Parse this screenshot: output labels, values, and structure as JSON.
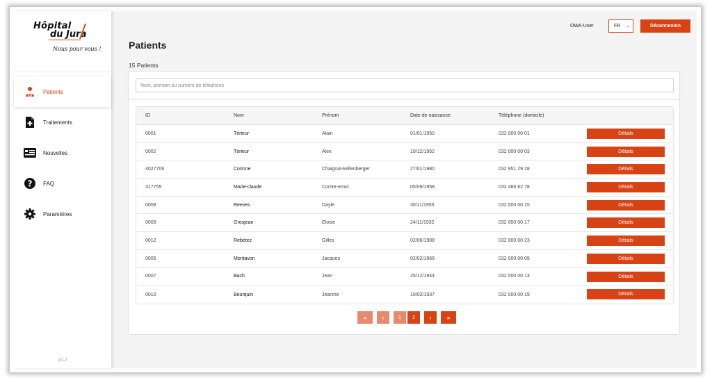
{
  "brand": {
    "name_line1": "Hôpital",
    "name_line2": "du Jura",
    "tagline": "Nous pour vous !",
    "accent_color": "#d84315"
  },
  "sidebar": {
    "items": [
      {
        "label": "Patients",
        "icon": "patient-icon",
        "active": true
      },
      {
        "label": "Traitements",
        "icon": "document-icon",
        "active": false
      },
      {
        "label": "Nouvelles",
        "icon": "news-icon",
        "active": false
      },
      {
        "label": "FAQ",
        "icon": "question-icon",
        "active": false
      },
      {
        "label": "Paramètres",
        "icon": "gear-icon",
        "active": false
      }
    ],
    "version": "v0.2"
  },
  "header": {
    "user": "OWA-User",
    "language": "FR",
    "logout_label": "Déconnexion"
  },
  "main": {
    "title": "Patients",
    "count_label": "15 Patients",
    "search_placeholder": "Nom, prénom ou numéro de téléphone"
  },
  "table": {
    "columns": [
      "ID",
      "Nom",
      "Prénom",
      "Date de naissance",
      "Téléphone (domicile)"
    ],
    "details_label": "Détails",
    "rows": [
      {
        "id": "0001",
        "nom": "Térieur",
        "prenom": "Alain",
        "date": "01/01/1950",
        "tel": "032 000 00 01"
      },
      {
        "id": "0002",
        "nom": "Térieur",
        "prenom": "Alex",
        "date": "10/12/1952",
        "tel": "032 000 00 03"
      },
      {
        "id": "4027706",
        "nom": "Corinne",
        "prenom": "Chaignat-kellenberger",
        "date": "27/01/1980",
        "tel": "032 951 29 28"
      },
      {
        "id": "317755",
        "nom": "Marie-claude",
        "prenom": "Comte-ernst",
        "date": "05/09/1958",
        "tel": "032 466 62 78"
      },
      {
        "id": "0008",
        "nom": "Reeves",
        "prenom": "Dayle",
        "date": "30/11/1955",
        "tel": "032 000 00 15"
      },
      {
        "id": "0009",
        "nom": "Grosjean",
        "prenom": "Eloise",
        "date": "24/11/1932",
        "tel": "032 000 00 17"
      },
      {
        "id": "0012",
        "nom": "Rebetez",
        "prenom": "Gilles",
        "date": "02/06/1908",
        "tel": "032 000 00 23"
      },
      {
        "id": "0005",
        "nom": "Montavon",
        "prenom": "Jacques",
        "date": "02/02/1966",
        "tel": "032 000 00 09"
      },
      {
        "id": "0007",
        "nom": "Bach",
        "prenom": "Jean",
        "date": "25/12/1944",
        "tel": "032 000 00 13"
      },
      {
        "id": "0010",
        "nom": "Bourquin",
        "prenom": "Jeanine",
        "date": "10/02/1937",
        "tel": "032 000 00 19"
      }
    ]
  },
  "pagination": {
    "first": "«",
    "prev": "‹",
    "pages": [
      "1",
      "2"
    ],
    "current_page": "2",
    "next": "›",
    "last": "»"
  }
}
